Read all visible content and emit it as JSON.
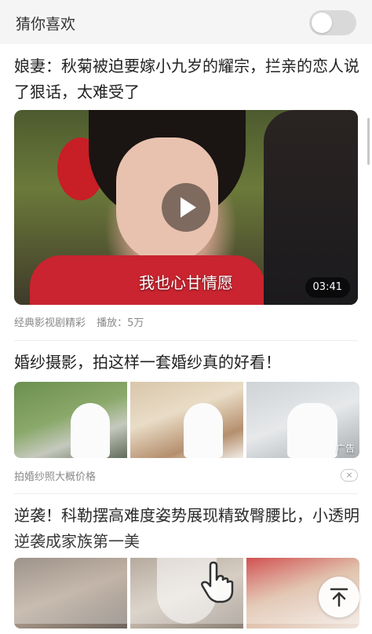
{
  "header": {
    "title": "猜你喜欢",
    "toggle_on": false
  },
  "feed": [
    {
      "title": "娘妻：秋菊被迫要嫁小九岁的耀宗，拦亲的恋人说了狠话，太难受了",
      "video_subtitle": "我也心甘情愿",
      "duration": "03:41",
      "source": "经典影视剧精彩",
      "plays": "播放：5万"
    },
    {
      "title": "婚纱摄影，拍这样一套婚纱真的好看！",
      "ad_label": "广告",
      "caption": "拍婚纱照大概价格",
      "close_glyph": "×"
    },
    {
      "title": "逆袭！科勒摆高难度姿势展现精致臀腰比，小透明逆袭成家族第一美"
    }
  ],
  "icons": {
    "play": "play-icon",
    "hand": "hand-pointer-icon",
    "back_to_top": "arrow-up-to-top-icon"
  },
  "colors": {
    "header_bg": "#f5f5f5",
    "toggle_off": "#d9d9d9",
    "meta_text": "#888888"
  }
}
